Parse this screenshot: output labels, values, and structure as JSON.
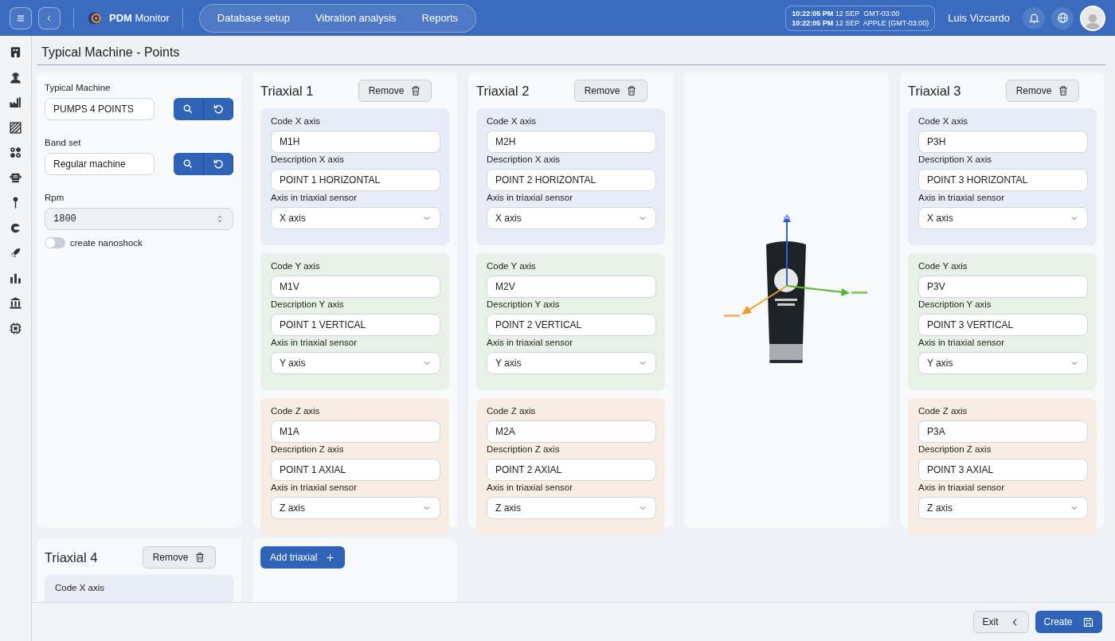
{
  "topbar": {
    "brand": "**PDM** Monitor",
    "nav": [
      {
        "label": "Database setup",
        "selected": false
      },
      {
        "label": "Vibration analysis",
        "selected": false
      },
      {
        "label": "Reports",
        "selected": false
      }
    ],
    "clock": [
      {
        "time": "10:22:05 PM",
        "detail": "12 SEP  GMT-03:00"
      },
      {
        "time": "10:22:05 PM",
        "detail": "12 SEP  APPLE (GMT-03:00)"
      }
    ],
    "user": "Luis Vizcardo"
  },
  "page_title": "Typical Machine - Points",
  "machine_panel": {
    "fields": [
      {
        "kind": "lookup",
        "label": "Typical Machine",
        "value": "PUMPS 4 POINTS"
      },
      {
        "kind": "lookup",
        "label": "Band set",
        "value": "Regular machine"
      },
      {
        "kind": "number",
        "label": "Rpm",
        "value": "1800"
      }
    ],
    "toggle": {
      "label": "create nanoshock",
      "on": false
    }
  },
  "triaxials": [
    {
      "title": "Triaxial 1",
      "remove": "Remove",
      "axes": [
        {
          "color": "#e7ecf6",
          "code_label": "Code X axis",
          "code": "M1H",
          "desc_label": "Description X axis",
          "desc": "POINT 1 HORIZONTAL",
          "sensor_label": "Axis in triaxial sensor",
          "sensor": "X axis"
        },
        {
          "color": "#e8f1e6",
          "code_label": "Code Y axis",
          "code": "M1V",
          "desc_label": "Description Y axis",
          "desc": "POINT 1 VERTICAL",
          "sensor_label": "Axis in triaxial sensor",
          "sensor": "Y axis"
        },
        {
          "color": "#f8ede2",
          "code_label": "Code Z axis",
          "code": "M1A",
          "desc_label": "Description Z axis",
          "desc": "POINT 1 AXIAL",
          "sensor_label": "Axis in triaxial sensor",
          "sensor": "Z axis"
        }
      ]
    },
    {
      "title": "Triaxial 2",
      "remove": "Remove",
      "axes": [
        {
          "color": "#e7ecf6",
          "code_label": "Code X axis",
          "code": "M2H",
          "desc_label": "Description X axis",
          "desc": "POINT 2 HORIZONTAL",
          "sensor_label": "Axis in triaxial sensor",
          "sensor": "X axis"
        },
        {
          "color": "#e8f1e6",
          "code_label": "Code Y axis",
          "code": "M2V",
          "desc_label": "Description Y axis",
          "desc": "POINT 2 VERTICAL",
          "sensor_label": "Axis in triaxial sensor",
          "sensor": "Y axis"
        },
        {
          "color": "#f8ede2",
          "code_label": "Code Z axis",
          "code": "M2A",
          "desc_label": "Description Z axis",
          "desc": "POINT 2 AXIAL",
          "sensor_label": "Axis in triaxial sensor",
          "sensor": "Z axis"
        }
      ]
    },
    {
      "title": "Triaxial 3",
      "remove": "Remove",
      "axes": [
        {
          "color": "#e7ecf6",
          "code_label": "Code X axis",
          "code": "P3H",
          "desc_label": "Description X axis",
          "desc": "POINT 3 HORIZONTAL",
          "sensor_label": "Axis in triaxial sensor",
          "sensor": "X axis"
        },
        {
          "color": "#e8f1e6",
          "code_label": "Code Y axis",
          "code": "P3V",
          "desc_label": "Description Y axis",
          "desc": "POINT 3 VERTICAL",
          "sensor_label": "Axis in triaxial sensor",
          "sensor": "Y axis"
        },
        {
          "color": "#f8ede2",
          "code_label": "Code Z axis",
          "code": "P3A",
          "desc_label": "Description Z axis",
          "desc": "POINT 3 AXIAL",
          "sensor_label": "Axis in triaxial sensor",
          "sensor": "Z axis"
        }
      ]
    },
    {
      "title": "Triaxial 4",
      "remove": "Remove",
      "axes": [
        {
          "color": "#e7ecf6",
          "code_label": "Code X axis"
        }
      ]
    }
  ],
  "add_button": "Add triaxial",
  "footer": {
    "exit": "Exit",
    "create": "Create"
  }
}
